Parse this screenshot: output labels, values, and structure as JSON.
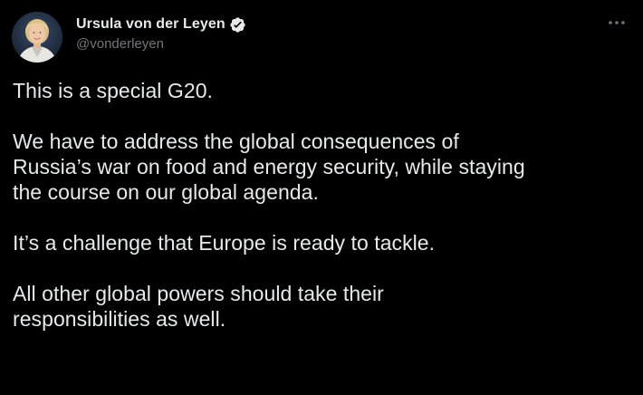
{
  "author": {
    "display_name": "Ursula von der Leyen",
    "handle": "@vonderleyen",
    "verified": true,
    "avatar_icon": "profile-photo",
    "verified_icon": "verified-badge-icon"
  },
  "actions": {
    "more_icon": "more-horizontal-icon"
  },
  "tweet": {
    "paragraphs": [
      "This is a special G20.",
      "We have to address the global consequences of\nRussia’s war on food and energy security, while staying\nthe course on our global agenda.",
      "It’s a challenge that Europe is ready to tackle.",
      "All other global powers should take their\nresponsibilities as well."
    ]
  },
  "colors": {
    "background": "#000000",
    "text": "#e7e9ea",
    "secondary_text": "#71767b",
    "accent": "#1d9bf0"
  }
}
